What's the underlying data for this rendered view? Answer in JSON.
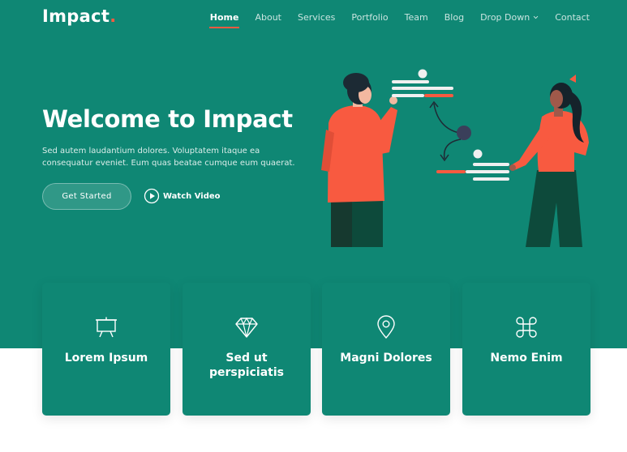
{
  "brand": {
    "name": "Impact",
    "dot": ".",
    "accent": "#f85a40",
    "primary": "#0f8774"
  },
  "nav": {
    "items": [
      {
        "label": "Home",
        "active": true
      },
      {
        "label": "About"
      },
      {
        "label": "Services"
      },
      {
        "label": "Portfolio"
      },
      {
        "label": "Team"
      },
      {
        "label": "Blog"
      },
      {
        "label": "Drop Down",
        "icon": "chevron-down-icon"
      },
      {
        "label": "Contact"
      }
    ]
  },
  "hero": {
    "title": "Welcome to Impact",
    "text": "Sed autem laudantium dolores. Voluptatem itaque ea consequatur eveniet. Eum quas beatae cumque eum quaerat.",
    "primary_button": "Get Started",
    "video_button": "Watch Video",
    "video_icon": "play-circle-icon"
  },
  "features": [
    {
      "title": "Lorem Ipsum",
      "icon": "easel-icon"
    },
    {
      "title": "Sed ut perspiciatis",
      "icon": "gem-icon"
    },
    {
      "title": "Magni Dolores",
      "icon": "map-pin-icon"
    },
    {
      "title": "Nemo Enim",
      "icon": "command-icon"
    }
  ]
}
